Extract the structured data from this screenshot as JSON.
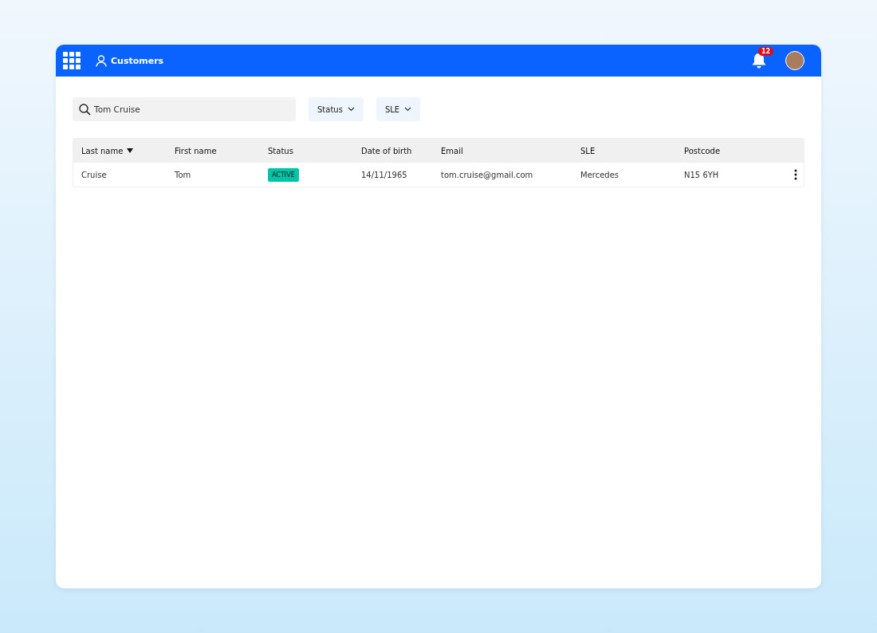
{
  "header": {
    "title": "Customers",
    "notification_count": "12"
  },
  "search": {
    "value": "Tom Cruise"
  },
  "filters": [
    {
      "label": "Status"
    },
    {
      "label": "SLE"
    }
  ],
  "table": {
    "columns": [
      {
        "label": "Last name",
        "sorted": true
      },
      {
        "label": "First name",
        "sorted": false
      },
      {
        "label": "Status",
        "sorted": false
      },
      {
        "label": "Date of birth",
        "sorted": false
      },
      {
        "label": "Email",
        "sorted": false
      },
      {
        "label": "SLE",
        "sorted": false
      },
      {
        "label": "Postcode",
        "sorted": false
      }
    ],
    "rows": [
      {
        "last_name": "Cruise",
        "first_name": "Tom",
        "status": {
          "label": "ACTIVE",
          "kind": "active"
        },
        "date_of_birth": "14/11/1965",
        "email": "tom.cruise@gmail.com",
        "sle": "Mercedes",
        "postcode": "N15 6YH"
      }
    ]
  }
}
